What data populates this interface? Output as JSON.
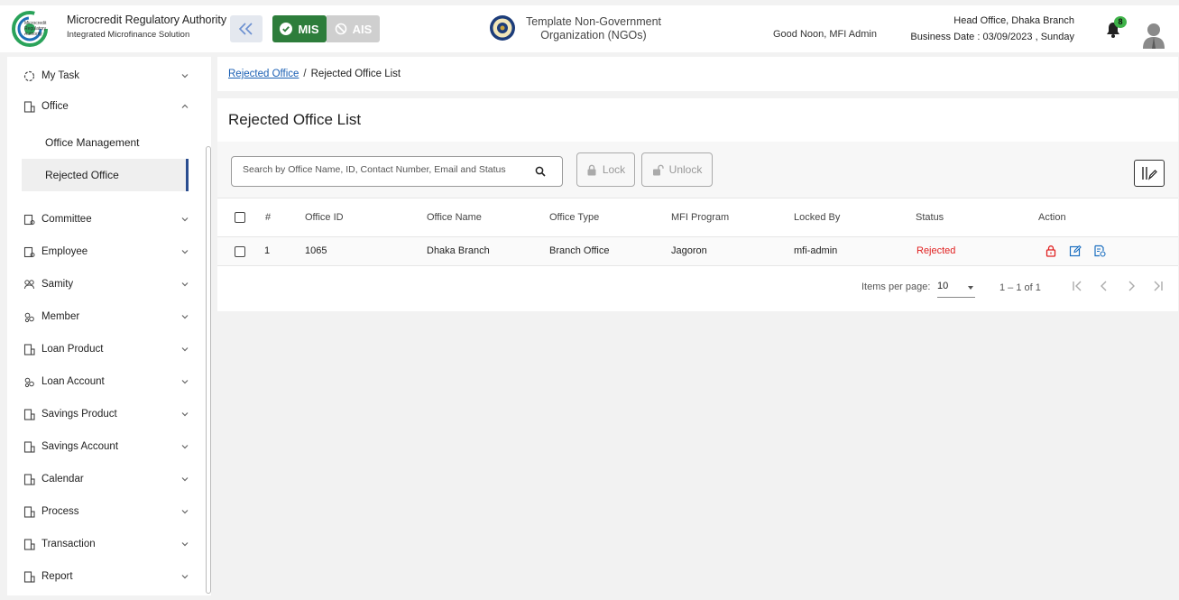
{
  "header": {
    "brand_title": "Microcredit Regulatory Authority",
    "brand_subtitle": "Integrated Microfinance Solution",
    "logo_text": [
      "Microcredit",
      "Regulatory",
      "Authority"
    ],
    "mis_label": "MIS",
    "ais_label": "AIS",
    "org_name_line1": "Template Non-Government",
    "org_name_line2": "Organization (NGOs)",
    "greeting": "Good Noon, MFI Admin",
    "office": "Head Office, Dhaka Branch",
    "business_date": "Business Date : 03/09/2023 , Sunday",
    "notification_count": "8",
    "icons": [
      "double-chevron-left-icon",
      "check-circle-icon",
      "ban-icon",
      "seal-icon",
      "bell-icon",
      "user-avatar-icon"
    ]
  },
  "sidebar": {
    "items": [
      {
        "label": "My Task",
        "icon": "task-icon",
        "expanded": false
      },
      {
        "label": "Office",
        "icon": "office-icon",
        "expanded": true
      },
      {
        "label": "Committee",
        "icon": "committee-icon",
        "expanded": false
      },
      {
        "label": "Employee",
        "icon": "employee-icon",
        "expanded": false
      },
      {
        "label": "Samity",
        "icon": "samity-icon",
        "expanded": false
      },
      {
        "label": "Member",
        "icon": "member-icon",
        "expanded": false
      },
      {
        "label": "Loan Product",
        "icon": "loan-product-icon",
        "expanded": false
      },
      {
        "label": "Loan Account",
        "icon": "loan-account-icon",
        "expanded": false
      },
      {
        "label": "Savings Product",
        "icon": "savings-product-icon",
        "expanded": false
      },
      {
        "label": "Savings Account",
        "icon": "savings-account-icon",
        "expanded": false
      },
      {
        "label": "Calendar",
        "icon": "calendar-icon",
        "expanded": false
      },
      {
        "label": "Process",
        "icon": "process-icon",
        "expanded": false
      },
      {
        "label": "Transaction",
        "icon": "transaction-icon",
        "expanded": false
      },
      {
        "label": "Report",
        "icon": "report-icon",
        "expanded": false
      }
    ],
    "office_sub": [
      {
        "label": "Office Management",
        "active": false
      },
      {
        "label": "Rejected Office",
        "active": true
      }
    ]
  },
  "breadcrumb": {
    "link": "Rejected Office",
    "separator": "/",
    "current": "Rejected Office List"
  },
  "main": {
    "title": "Rejected Office List",
    "search_placeholder": "Search by Office Name, ID, Contact Number, Email and Status",
    "lock_label": "Lock",
    "unlock_label": "Unlock",
    "columns": [
      "#",
      "Office ID",
      "Office Name",
      "Office Type",
      "MFI Program",
      "Locked By",
      "Status",
      "Action"
    ],
    "rows": [
      {
        "num": "1",
        "office_id": "1065",
        "office_name": "Dhaka Branch",
        "office_type": "Branch Office",
        "mfi_program": "Jagoron",
        "locked_by": "mfi-admin",
        "status": "Rejected",
        "actions": [
          "lock-icon",
          "edit-icon",
          "details-icon"
        ]
      }
    ],
    "paginator": {
      "items_per_page_label": "Items per page:",
      "items_per_page": "10",
      "range": "1 – 1 of 1"
    }
  },
  "colors": {
    "accent_green": "#2d7d3b",
    "status_rejected": "#e02020",
    "link_blue": "#1a5fb4",
    "active_bar": "#2a4d8f"
  }
}
